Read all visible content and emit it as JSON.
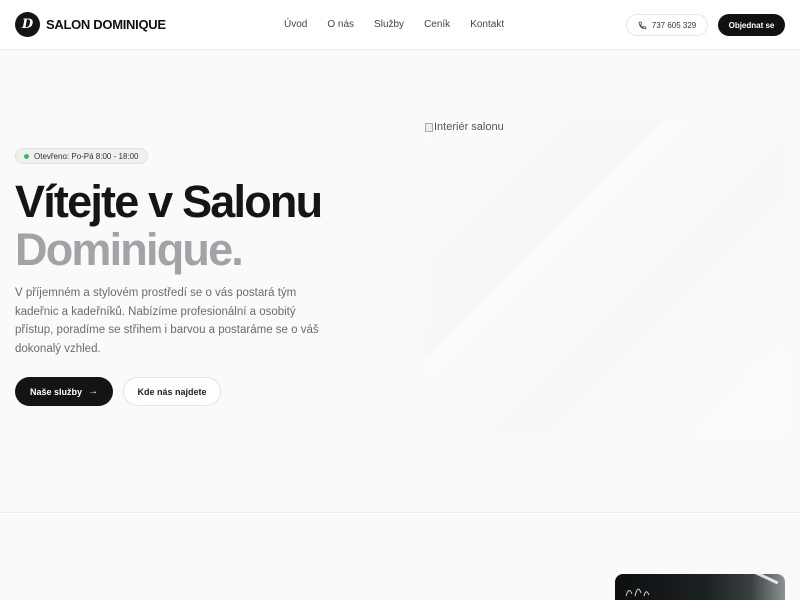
{
  "brand": {
    "mark": "D",
    "name": "SALON DOMINIQUE"
  },
  "nav": {
    "items": [
      "Úvod",
      "O nás",
      "Služby",
      "Ceník",
      "Kontakt"
    ]
  },
  "header": {
    "phone": "737 605 329",
    "order_label": "Objednat se"
  },
  "hero": {
    "badge": "Otevřeno: Po-Pá 8:00 - 18:00",
    "title_line1": "Vítejte v Salonu",
    "title_line2": "Dominique.",
    "lead": "V příjemném a stylovém prostředí se o vás postará tým kadeřnic a kadeřníků. Nabízíme profesionální a osobitý přístup, poradíme se střihem i barvou a postaráme se o váš dokonalý vzhled.",
    "primary_button": "Naše služby",
    "secondary_button": "Kde nás najdete",
    "image_alt": "Interiér salonu"
  },
  "colors": {
    "accent": "#111111",
    "status_open": "#2fbf5f",
    "title_muted": "#a3a3a7"
  },
  "icons": [
    "phone-icon",
    "arrow-right-icon",
    "status-dot-icon",
    "broken-image-icon"
  ]
}
